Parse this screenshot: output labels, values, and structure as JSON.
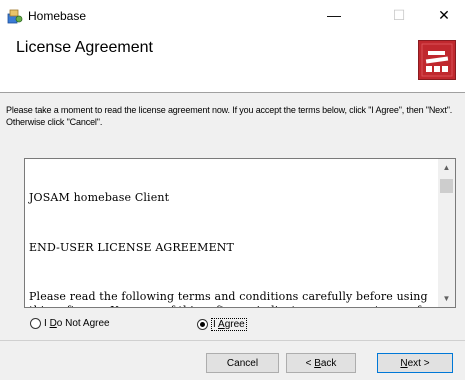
{
  "window": {
    "title": "Homebase",
    "minimize_glyph": "—",
    "maximize_glyph": "☐",
    "close_glyph": "✕",
    "icon": "installer-icon"
  },
  "header": {
    "title": "License Agreement",
    "logo": "vehicle-sign-logo",
    "logo_color": "#c0282e"
  },
  "instruction": "Please take a moment to read the license agreement now. If you accept the terms below, click \"I Agree\", then \"Next\". Otherwise click \"Cancel\".",
  "license": {
    "paragraphs": [
      "JOSAM homebase Client",
      "END-USER LICENSE AGREEMENT",
      "Please read the following terms and conditions carefully before using this software. Your use of this software indicates your acceptance of this license agreement. If you do not agree with the terms of this license, you must remove this software from your storage devices and cease to use the product."
    ]
  },
  "radios": {
    "disagree": {
      "prefix": "I ",
      "accel": "D",
      "rest": "o Not Agree",
      "checked": false
    },
    "agree": {
      "prefix": "I ",
      "accel": "A",
      "rest": "gree",
      "checked": true
    }
  },
  "buttons": {
    "cancel": "Cancel",
    "back": {
      "pre": "< ",
      "accel": "B",
      "rest": "ack"
    },
    "next": {
      "accel": "N",
      "rest": "ext >"
    }
  }
}
